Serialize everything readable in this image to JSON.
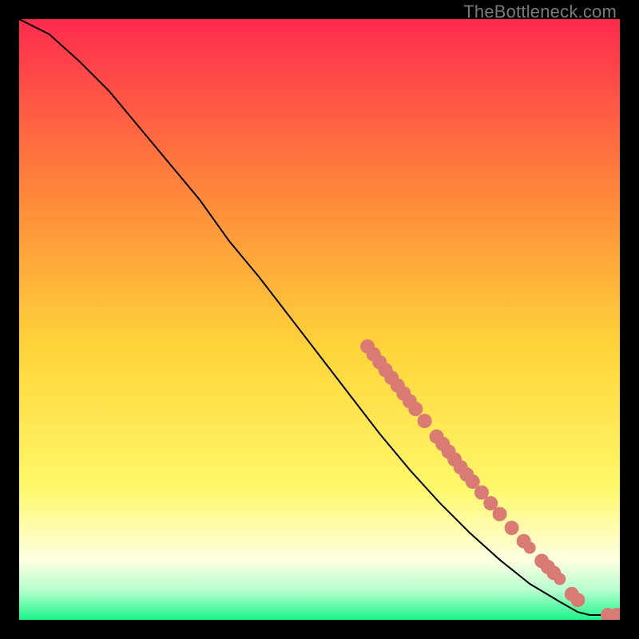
{
  "attribution": "TheBottleneck.com",
  "colors": {
    "gradient_top": "#ff2b4e",
    "gradient_mid_upper": "#ff8a3a",
    "gradient_mid": "#ffd53a",
    "gradient_mid_lower": "#fff86a",
    "gradient_pale": "#fdffe0",
    "gradient_green_pale": "#b9ffcf",
    "gradient_green": "#19f58a",
    "curve_stroke": "#000000",
    "dot_fill": "#d97a74"
  },
  "chart_data": {
    "type": "line",
    "title": "",
    "xlabel": "",
    "ylabel": "",
    "xlim": [
      0,
      100
    ],
    "ylim": [
      0,
      100
    ],
    "curve": [
      {
        "x": 0,
        "y": 100
      },
      {
        "x": 5,
        "y": 97.5
      },
      {
        "x": 10,
        "y": 93
      },
      {
        "x": 15,
        "y": 88
      },
      {
        "x": 20,
        "y": 82
      },
      {
        "x": 25,
        "y": 76
      },
      {
        "x": 30,
        "y": 70
      },
      {
        "x": 35,
        "y": 63
      },
      {
        "x": 40,
        "y": 57
      },
      {
        "x": 45,
        "y": 50.5
      },
      {
        "x": 50,
        "y": 44
      },
      {
        "x": 55,
        "y": 37.5
      },
      {
        "x": 60,
        "y": 31
      },
      {
        "x": 65,
        "y": 25
      },
      {
        "x": 70,
        "y": 19.5
      },
      {
        "x": 75,
        "y": 14.5
      },
      {
        "x": 80,
        "y": 10
      },
      {
        "x": 85,
        "y": 6
      },
      {
        "x": 90,
        "y": 3
      },
      {
        "x": 93,
        "y": 1.3
      },
      {
        "x": 95,
        "y": 0.8
      },
      {
        "x": 100,
        "y": 0.8
      }
    ],
    "dots": [
      {
        "x": 58,
        "y": 45.5,
        "r": 1.2
      },
      {
        "x": 59,
        "y": 44.2,
        "r": 1.2
      },
      {
        "x": 60,
        "y": 42.9,
        "r": 1.2
      },
      {
        "x": 61,
        "y": 41.6,
        "r": 1.2
      },
      {
        "x": 62,
        "y": 40.3,
        "r": 1.2
      },
      {
        "x": 63,
        "y": 39.0,
        "r": 1.2
      },
      {
        "x": 64,
        "y": 37.7,
        "r": 1.2
      },
      {
        "x": 65,
        "y": 36.4,
        "r": 1.2
      },
      {
        "x": 66,
        "y": 35.1,
        "r": 1.2
      },
      {
        "x": 67.5,
        "y": 33.1,
        "r": 1.2
      },
      {
        "x": 69.5,
        "y": 30.5,
        "r": 1.2
      },
      {
        "x": 70.5,
        "y": 29.3,
        "r": 1.2
      },
      {
        "x": 71.5,
        "y": 28.0,
        "r": 1.2
      },
      {
        "x": 72.5,
        "y": 26.7,
        "r": 1.2
      },
      {
        "x": 73.5,
        "y": 25.4,
        "r": 1.2
      },
      {
        "x": 74.5,
        "y": 24.2,
        "r": 1.2
      },
      {
        "x": 75.5,
        "y": 23.0,
        "r": 1.2
      },
      {
        "x": 77,
        "y": 21.2,
        "r": 1.2
      },
      {
        "x": 78.5,
        "y": 19.4,
        "r": 1.2
      },
      {
        "x": 80,
        "y": 17.6,
        "r": 1.2
      },
      {
        "x": 82,
        "y": 15.3,
        "r": 1.2
      },
      {
        "x": 84,
        "y": 13.1,
        "r": 1.2
      },
      {
        "x": 85,
        "y": 12.0,
        "r": 1.0
      },
      {
        "x": 87,
        "y": 9.8,
        "r": 1.2
      },
      {
        "x": 88,
        "y": 8.8,
        "r": 1.2
      },
      {
        "x": 89,
        "y": 7.8,
        "r": 1.2
      },
      {
        "x": 90,
        "y": 6.8,
        "r": 1.0
      },
      {
        "x": 92,
        "y": 4.3,
        "r": 1.2
      },
      {
        "x": 93,
        "y": 3.3,
        "r": 1.2
      },
      {
        "x": 98,
        "y": 0.8,
        "r": 1.2
      },
      {
        "x": 99.5,
        "y": 0.8,
        "r": 1.2
      }
    ]
  }
}
